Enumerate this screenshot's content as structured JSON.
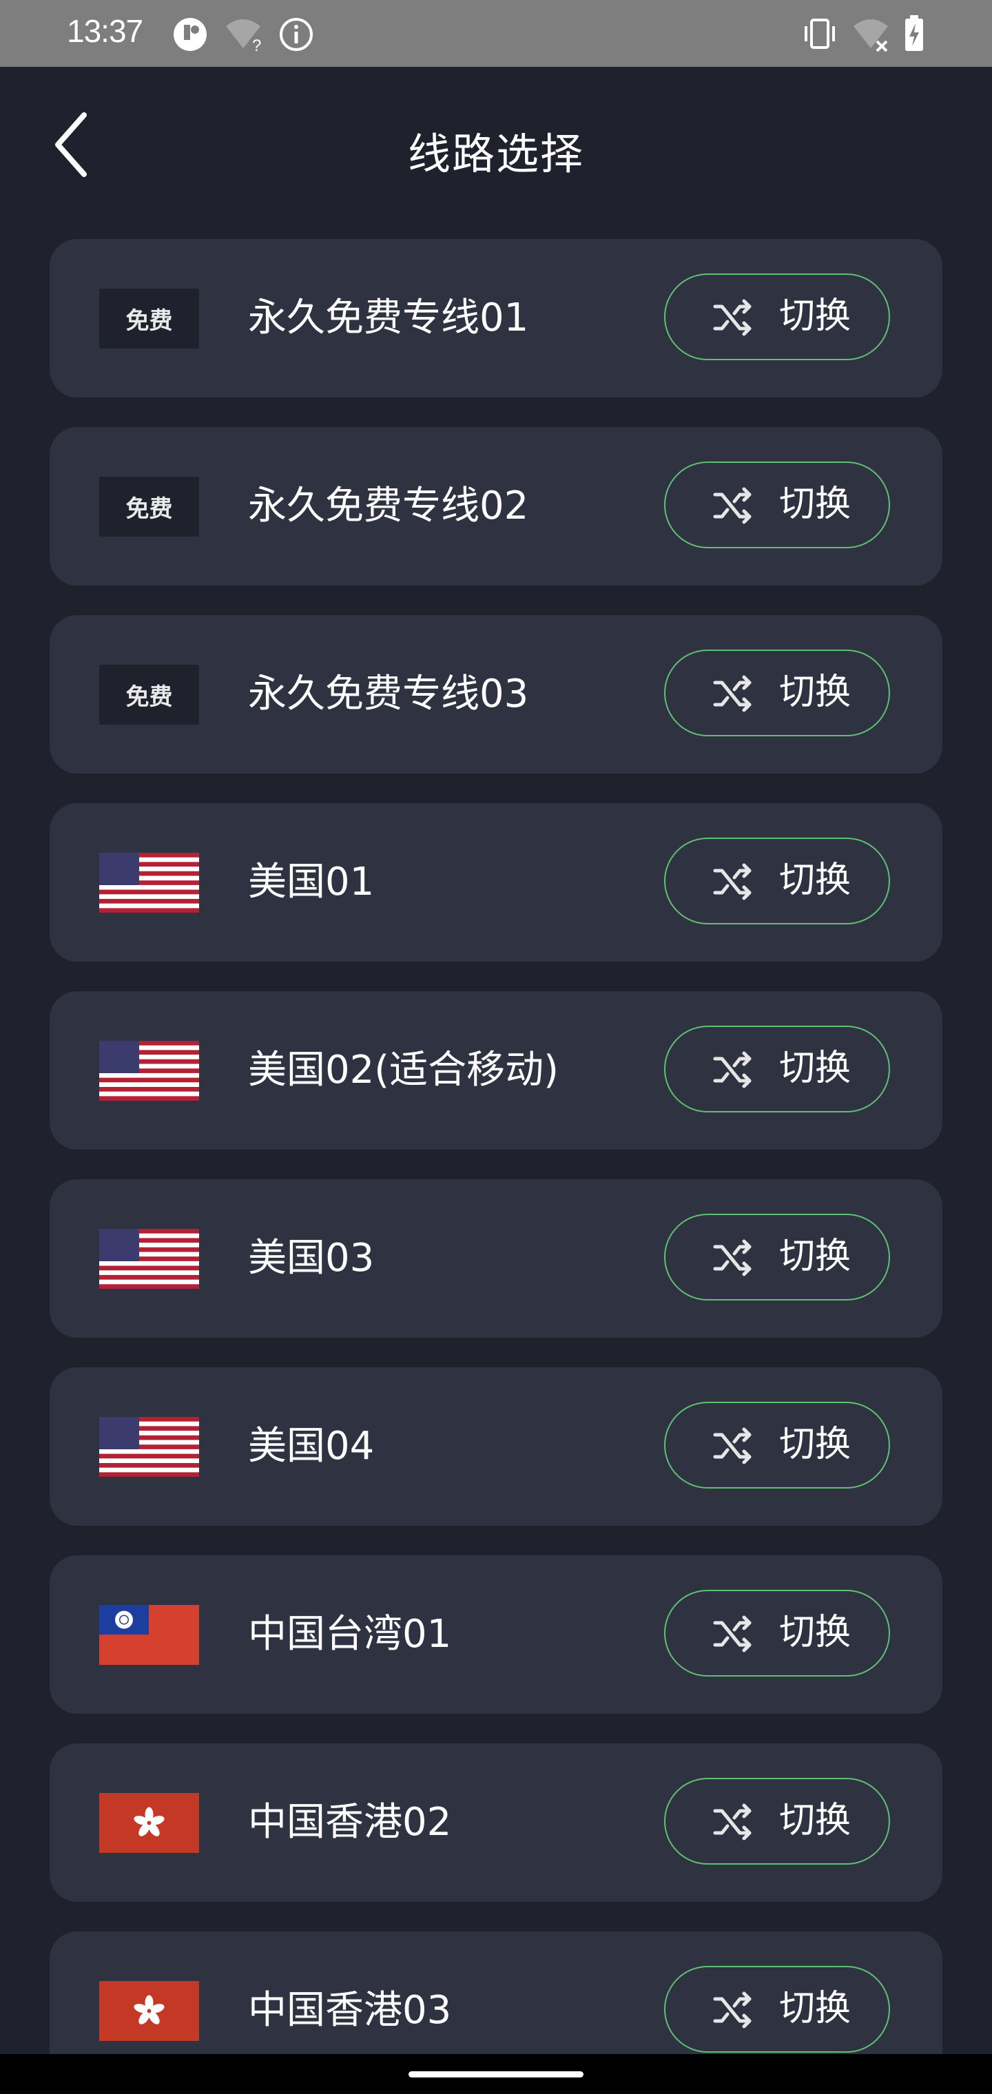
{
  "status_bar": {
    "time": "13:37",
    "icons": [
      "app-notification-icon",
      "wifi-question-icon",
      "info-icon",
      "vibrate-icon",
      "wifi-off-icon",
      "battery-charging-icon"
    ]
  },
  "header": {
    "back_icon": "chevron-left-icon",
    "title": "线路选择"
  },
  "switch_button": {
    "label": "切换",
    "icon": "shuffle-icon",
    "border_color": "#5fbf73"
  },
  "colors": {
    "background": "#1f222c",
    "card": "#2f3341",
    "accent_green": "#5fbf73"
  },
  "routes": [
    {
      "icon": "free-badge",
      "badge": "免费",
      "name": "永久免费专线01"
    },
    {
      "icon": "free-badge",
      "badge": "免费",
      "name": "永久免费专线02"
    },
    {
      "icon": "free-badge",
      "badge": "免费",
      "name": "永久免费专线03"
    },
    {
      "icon": "us-flag-icon",
      "name": "美国01"
    },
    {
      "icon": "us-flag-icon",
      "name": "美国02(适合移动)"
    },
    {
      "icon": "us-flag-icon",
      "name": "美国03"
    },
    {
      "icon": "us-flag-icon",
      "name": "美国04"
    },
    {
      "icon": "taiwan-flag-icon",
      "name": "中国台湾01"
    },
    {
      "icon": "hongkong-flag-icon",
      "name": "中国香港02"
    },
    {
      "icon": "hongkong-flag-icon",
      "name": "中国香港03"
    }
  ]
}
